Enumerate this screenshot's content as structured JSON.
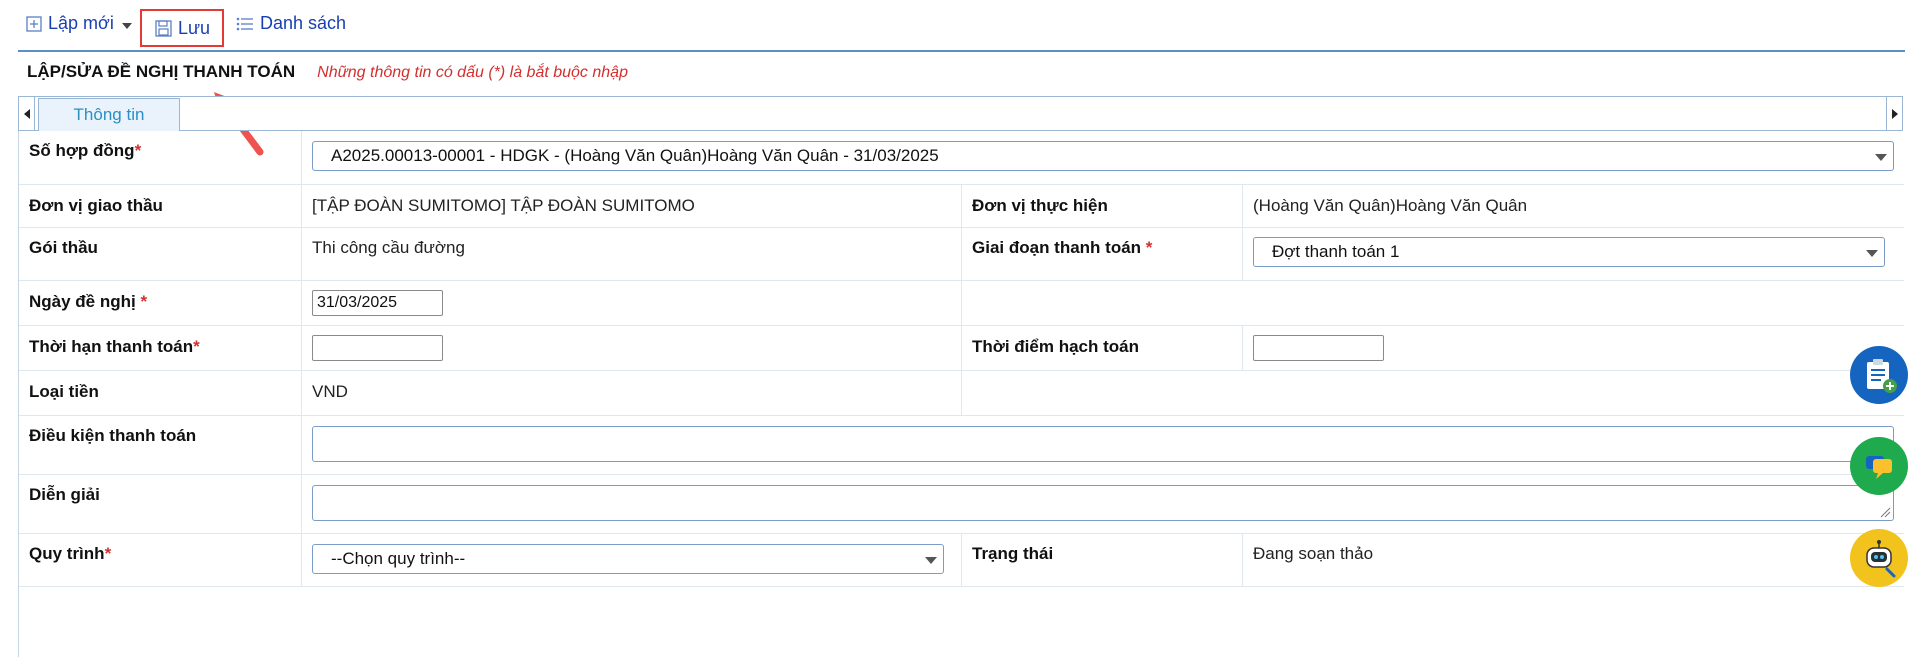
{
  "toolbar": {
    "new_label": "Lập mới",
    "save_label": "Lưu",
    "list_label": "Danh sách"
  },
  "header": {
    "title": "LẬP/SỬA ĐỀ NGHỊ THANH TOÁN",
    "note": "Những thông tin có dấu (*) là bắt buộc nhập"
  },
  "tabs": [
    {
      "label": "Thông tin"
    }
  ],
  "form": {
    "contract_no": {
      "label": "Số hợp đồng",
      "value": "A2025.00013-00001 - HDGK - (Hoàng Văn Quân)Hoàng Văn Quân - 31/03/2025"
    },
    "contractor_unit": {
      "label": "Đơn vị giao thầu",
      "value": "[TẬP ĐOÀN SUMITOMO] TẬP ĐOÀN SUMITOMO"
    },
    "executing_unit": {
      "label": "Đơn vị thực hiện",
      "value": "(Hoàng Văn Quân)Hoàng Văn Quân"
    },
    "package": {
      "label": "Gói thầu",
      "value": "Thi công cầu đường"
    },
    "payment_phase": {
      "label": "Giai đoạn thanh toán",
      "value": "Đợt thanh toán 1"
    },
    "request_date": {
      "label": "Ngày đề nghị",
      "value": "31/03/2025"
    },
    "payment_deadline": {
      "label": "Thời hạn thanh toán",
      "value": ""
    },
    "accounting_time": {
      "label": "Thời điểm hạch toán",
      "value": ""
    },
    "currency": {
      "label": "Loại tiền",
      "value": "VND"
    },
    "payment_terms": {
      "label": "Điều kiện thanh toán",
      "value": ""
    },
    "description": {
      "label": "Diễn giải",
      "value": ""
    },
    "workflow": {
      "label": "Quy trình",
      "value": "--Chọn quy trình--"
    },
    "status": {
      "label": "Trạng thái",
      "value": "Đang soạn thảo"
    },
    "required_mark": "*"
  },
  "colors": {
    "accent_blue": "#1a3fb0",
    "tab_text": "#2a8fc2",
    "required_red": "#d32f2f",
    "highlight_red": "#e53935",
    "fab_blue": "#1565c0",
    "fab_green": "#1faa4d",
    "fab_yellow": "#f3c31d"
  },
  "icons": {
    "new": "plus-square-icon",
    "save": "floppy-disk-icon",
    "list": "list-icon",
    "fab1": "clipboard-add-icon",
    "fab2": "chat-icon",
    "fab3": "robot-icon",
    "pointer": "red-arrow-annotation"
  }
}
